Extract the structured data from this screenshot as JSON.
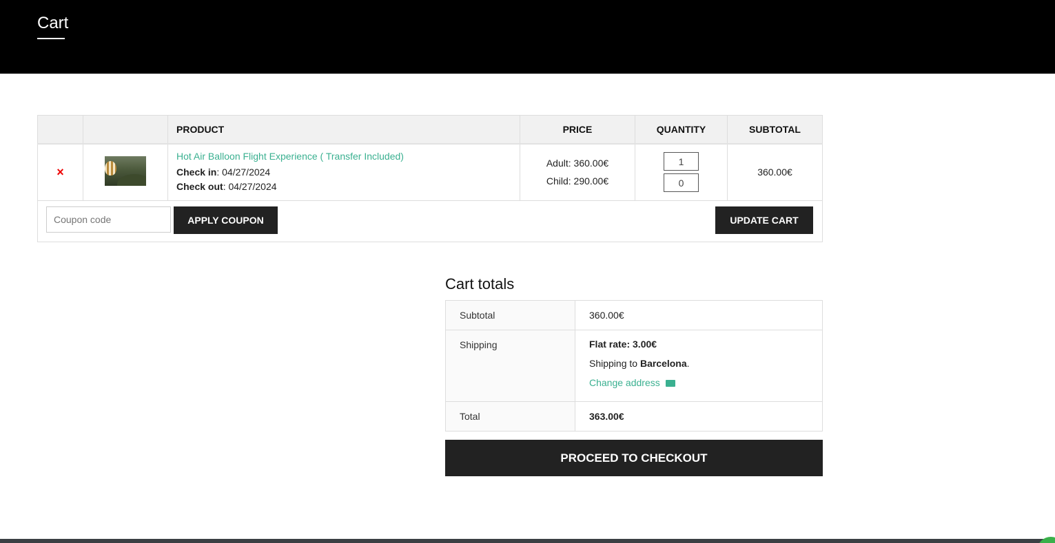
{
  "header": {
    "title": "Cart"
  },
  "cart_table": {
    "columns": [
      "",
      "",
      "PRODUCT",
      "PRICE",
      "QUANTITY",
      "SUBTOTAL"
    ],
    "rows": [
      {
        "remove_glyph": "×",
        "thumbnail_icon": "balloon-photo",
        "product_name": "Hot Air Balloon Flight Experience ( Transfer Included)",
        "check_in_label": "Check in",
        "check_in_value": ": 04/27/2024",
        "check_out_label": "Check out",
        "check_out_value": ": 04/27/2024",
        "price_adult": "Adult: 360.00€",
        "price_child": "Child: 290.00€",
        "qty_adult": "1",
        "qty_child": "0",
        "subtotal": "360.00€"
      }
    ]
  },
  "coupon": {
    "placeholder": "Coupon code",
    "apply_label": "APPLY COUPON"
  },
  "update_cart_label": "UPDATE CART",
  "totals": {
    "title": "Cart totals",
    "subtotal_label": "Subtotal",
    "subtotal_value": "360.00€",
    "shipping_label": "Shipping",
    "shipping_rate": "Flat rate: 3.00€",
    "shipping_to_prefix": "Shipping to ",
    "shipping_city": "Barcelona",
    "shipping_to_suffix": ".",
    "change_address_label": "Change address",
    "total_label": "Total",
    "total_value": "363.00€"
  },
  "checkout_label": "PROCEED TO CHECKOUT",
  "colors": {
    "accent": "#3ab090",
    "dark_button": "#222222",
    "remove": "#ee0000",
    "header_bg": "#000000"
  }
}
